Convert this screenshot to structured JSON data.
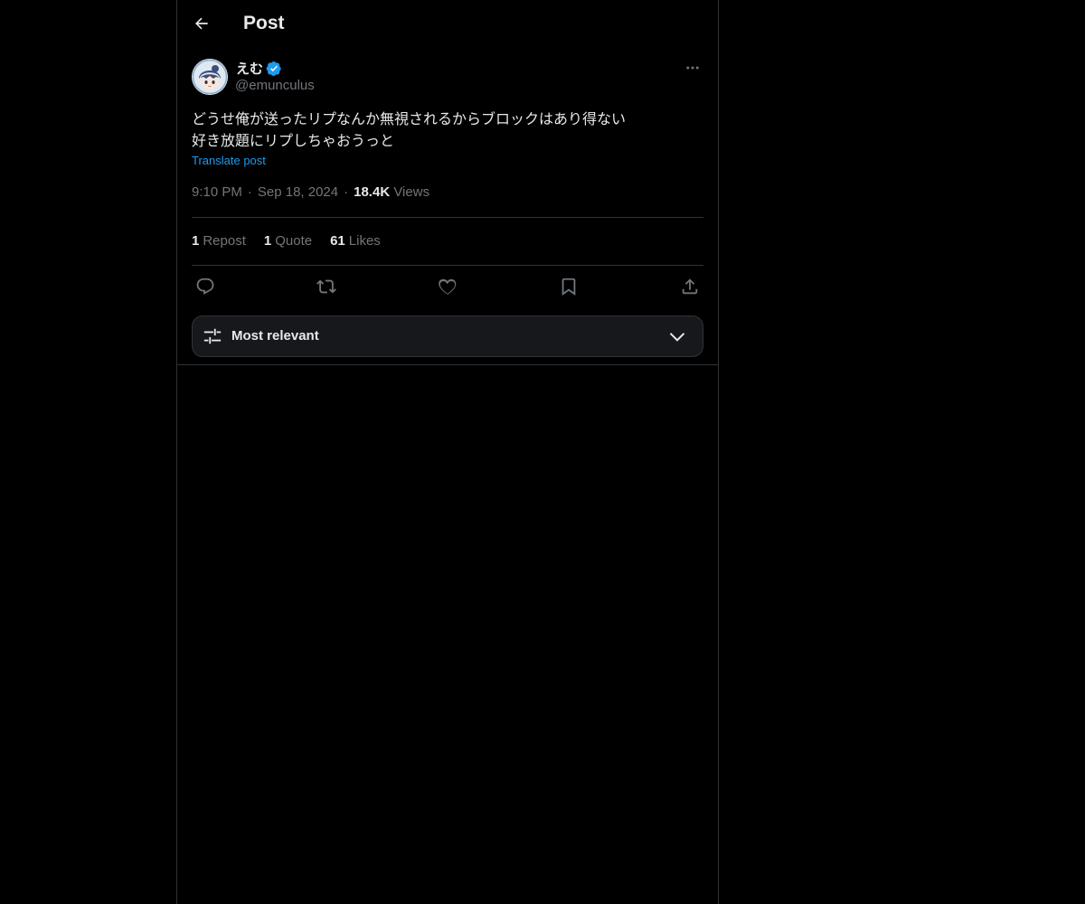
{
  "header": {
    "title": "Post",
    "back_icon": "arrow-left-icon"
  },
  "post": {
    "author": {
      "display_name": "えむ",
      "handle": "@emunculus",
      "verified": true,
      "avatar_icon": "avatar-illustration"
    },
    "text_lines": [
      "どうせ俺が送ったリプなんか無視されるからブロックはあり得ない",
      "好き放題にリプしちゃおうっと"
    ],
    "translate_label": "Translate post",
    "time": "9:10 PM",
    "date": "Sep 18, 2024",
    "separator": "·",
    "views_count": "18.4K",
    "views_label": "Views",
    "stats": {
      "reposts_count": "1",
      "reposts_label": "Repost",
      "quotes_count": "1",
      "quotes_label": "Quote",
      "likes_count": "61",
      "likes_label": "Likes"
    },
    "actions": [
      "reply-icon",
      "repost-icon",
      "like-icon",
      "bookmark-icon",
      "share-icon"
    ]
  },
  "replies_sort": {
    "label": "Most relevant",
    "icon": "sliders-icon",
    "chevron": "chevron-down-icon"
  },
  "colors": {
    "background": "#000000",
    "text": "#e7e9ea",
    "secondary_text": "#71767b",
    "accent": "#1d9bf0",
    "border": "#2f3336"
  }
}
